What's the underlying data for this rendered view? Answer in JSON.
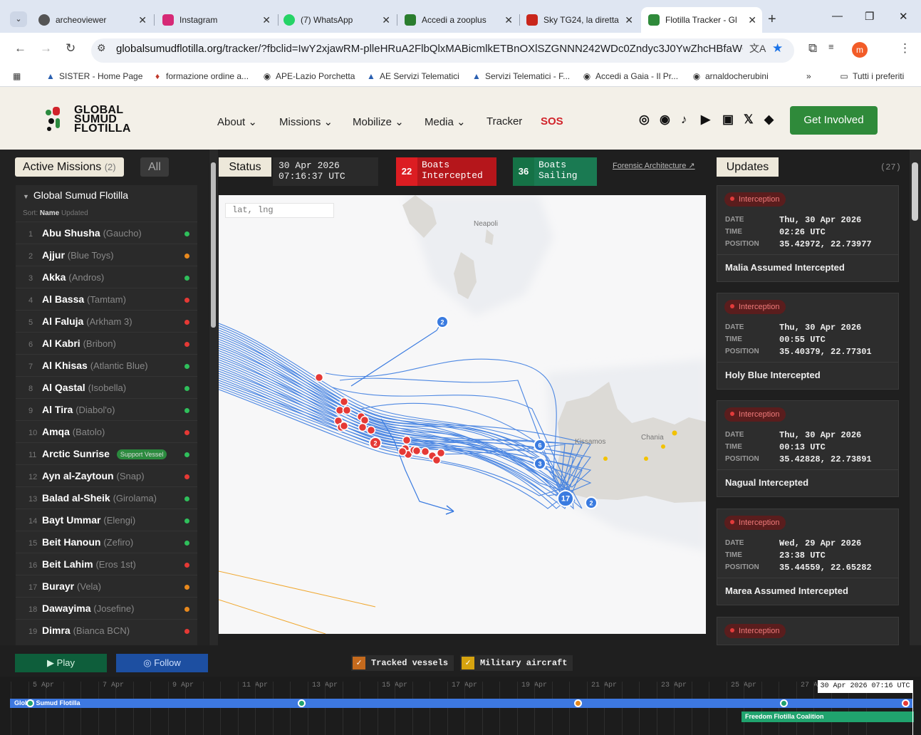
{
  "browser": {
    "tabs": [
      {
        "title": "archeoviewer",
        "favicon_color": "#555555"
      },
      {
        "title": "Instagram",
        "favicon_color": "#d62976"
      },
      {
        "title": "(7) WhatsApp",
        "favicon_color": "#25d366"
      },
      {
        "title": "Accedi a zooplus",
        "favicon_color": "#2a7d2e"
      },
      {
        "title": "Sky TG24, la diretta",
        "favicon_color": "#c9261b"
      },
      {
        "title": "Flotilla Tracker - Gl",
        "favicon_color": "#2f8a3a"
      }
    ],
    "url_domain": "globalsumudflotilla.org",
    "url_path": "/tracker/?fbclid=IwY2xjawRM-plleHRuA2FlbQlxMABicmlkETBnOXlSZGNNN242WDc0Zndyc3J0YwZhcHBfaWQQMjly...",
    "profile_initial": "m",
    "bookmarks": [
      "SISTER - Home Page",
      "formazione ordine a...",
      "APE-Lazio Porchetta",
      "AE Servizi Telematici",
      "Servizi Telematici - F...",
      "Accedi a Gaia - Il Pr...",
      "arnaldocherubini"
    ],
    "bookmarks_more": "»",
    "all_bookmarks": "Tutti i preferiti"
  },
  "site": {
    "logo_lines": [
      "GLOBAL",
      "SUMUD",
      "FLOTILLA"
    ],
    "menu": [
      {
        "label": "About",
        "dropdown": true
      },
      {
        "label": "Missions",
        "dropdown": true
      },
      {
        "label": "Mobilize",
        "dropdown": true
      },
      {
        "label": "Media",
        "dropdown": true
      },
      {
        "label": "Tracker",
        "dropdown": false
      }
    ],
    "sos_label": "SOS",
    "social_icons": [
      "instagram-icon",
      "telegram-icon",
      "tiktok-icon",
      "youtube-icon",
      "linkedin-icon",
      "x-icon",
      "mastodon-icon"
    ],
    "cta_label": "Get Involved"
  },
  "tracker": {
    "active_missions_label": "Active Missions",
    "active_missions_count": "(2)",
    "all_label": "All",
    "fleet_name": "Global Sumud Flotilla",
    "sort_label": "Sort:",
    "sort_name": "Name",
    "sort_updated": "Updated",
    "vessels": [
      {
        "n": "1",
        "name": "Abu Shusha",
        "alias": "(Gaucho)",
        "status": "#2fbf5b"
      },
      {
        "n": "2",
        "name": "Ajjur",
        "alias": "(Blue Toys)",
        "status": "#e8891d"
      },
      {
        "n": "3",
        "name": "Akka",
        "alias": "(Andros)",
        "status": "#2fbf5b"
      },
      {
        "n": "4",
        "name": "Al Bassa",
        "alias": "(Tamtam)",
        "status": "#e53935"
      },
      {
        "n": "5",
        "name": "Al Faluja",
        "alias": "(Arkham 3)",
        "status": "#e53935"
      },
      {
        "n": "6",
        "name": "Al Kabri",
        "alias": "(Bribon)",
        "status": "#e53935"
      },
      {
        "n": "7",
        "name": "Al Khisas",
        "alias": "(Atlantic Blue)",
        "status": "#2fbf5b"
      },
      {
        "n": "8",
        "name": "Al Qastal",
        "alias": "(Isobella)",
        "status": "#2fbf5b"
      },
      {
        "n": "9",
        "name": "Al Tira",
        "alias": "(Diabol'o)",
        "status": "#2fbf5b"
      },
      {
        "n": "10",
        "name": "Amqa",
        "alias": "(Batolo)",
        "status": "#e53935"
      },
      {
        "n": "11",
        "name": "Arctic Sunrise",
        "alias": "",
        "badge": "Support Vessel",
        "status": "#2fbf5b"
      },
      {
        "n": "12",
        "name": "Ayn al-Zaytoun",
        "alias": "(Snap)",
        "status": "#e53935"
      },
      {
        "n": "13",
        "name": "Balad al-Sheik",
        "alias": "(Girolama)",
        "status": "#2fbf5b"
      },
      {
        "n": "14",
        "name": "Bayt Ummar",
        "alias": "(Elengi)",
        "status": "#2fbf5b"
      },
      {
        "n": "15",
        "name": "Beit Hanoun",
        "alias": "(Zefiro)",
        "status": "#2fbf5b"
      },
      {
        "n": "16",
        "name": "Beit Lahim",
        "alias": "(Eros 1st)",
        "status": "#e53935"
      },
      {
        "n": "17",
        "name": "Burayr",
        "alias": "(Vela)",
        "status": "#e8891d"
      },
      {
        "n": "18",
        "name": "Dawayima",
        "alias": "(Josefine)",
        "status": "#e8891d"
      },
      {
        "n": "19",
        "name": "Dimra",
        "alias": "(Bianca BCN)",
        "status": "#e53935"
      }
    ],
    "status_label": "Status",
    "status_date": "30 Apr 2026",
    "status_time": "07:16:37 UTC",
    "intercepted_count": "22",
    "intercepted_label": [
      "Boats",
      "Intercepted"
    ],
    "sailing_count": "36",
    "sailing_label": [
      "Boats",
      "Sailing"
    ],
    "forensic_link": "Forensic Architecture ↗",
    "map": {
      "coords_placeholder": "lat, lng",
      "places": [
        "Neapoli",
        "Kissamos",
        "Chania"
      ],
      "clusters": [
        "2",
        "2",
        "6",
        "3",
        "17",
        "2"
      ],
      "colors": {
        "track": "#3a7be0",
        "intercepted": "#e53935",
        "sailing": "#3a7be0",
        "land": "#dcdad6"
      }
    },
    "updates_label": "Updates",
    "updates_count": "(27)",
    "updates": [
      {
        "type": "Interception",
        "date": "Thu, 30 Apr 2026",
        "time": "02:26 UTC",
        "position": "35.42972, 22.73977",
        "title": "Malia Assumed Intercepted"
      },
      {
        "type": "Interception",
        "date": "Thu, 30 Apr 2026",
        "time": "00:55 UTC",
        "position": "35.40379, 22.77301",
        "title": "Holy Blue Intercepted"
      },
      {
        "type": "Interception",
        "date": "Thu, 30 Apr 2026",
        "time": "00:13 UTC",
        "position": "35.42828, 22.73891",
        "title": "Nagual Intercepted"
      },
      {
        "type": "Interception",
        "date": "Wed, 29 Apr 2026",
        "time": "23:38 UTC",
        "position": "35.44559, 22.65282",
        "title": "Marea Assumed Intercepted"
      },
      {
        "type": "Interception"
      }
    ],
    "field_labels": {
      "date": "DATE",
      "time": "TIME",
      "position": "POSITION"
    },
    "play_label": "▶ Play",
    "follow_label": "◎ Follow",
    "tracked_vessels_label": "Tracked vessels",
    "military_aircraft_label": "Military aircraft",
    "timeline": {
      "dates": [
        "5 Apr",
        "7 Apr",
        "9 Apr",
        "11 Apr",
        "13 Apr",
        "15 Apr",
        "17 Apr",
        "19 Apr",
        "21 Apr",
        "23 Apr",
        "25 Apr",
        "27 Apr"
      ],
      "now_label": "30 Apr 2026 07:16 UTC",
      "tracks": [
        "Global Sumud Flotilla",
        "Freedom Flotilla Coalition"
      ]
    }
  }
}
